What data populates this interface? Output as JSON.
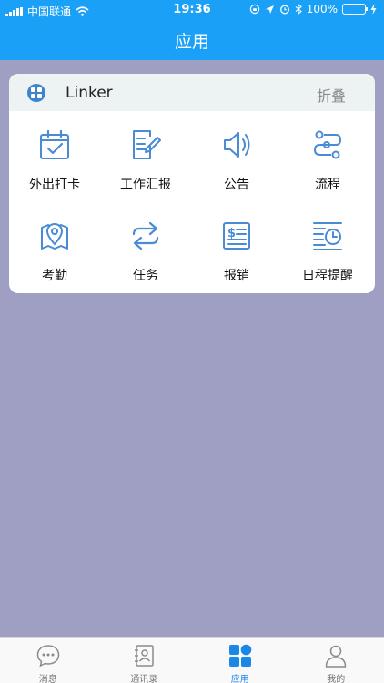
{
  "status_bar": {
    "carrier": "中国联通",
    "time": "19:36",
    "battery": "100%",
    "battery_level": 1.0
  },
  "header": {
    "title": "应用"
  },
  "card": {
    "app_name": "Linker",
    "fold_label": "折叠",
    "items": [
      {
        "label": "外出打卡",
        "icon": "calendar-check-icon"
      },
      {
        "label": "工作汇报",
        "icon": "report-edit-icon"
      },
      {
        "label": "公告",
        "icon": "speaker-icon"
      },
      {
        "label": "流程",
        "icon": "workflow-icon"
      },
      {
        "label": "考勤",
        "icon": "map-pin-icon"
      },
      {
        "label": "任务",
        "icon": "swap-arrows-icon"
      },
      {
        "label": "报销",
        "icon": "receipt-dollar-icon"
      },
      {
        "label": "日程提醒",
        "icon": "schedule-clock-icon"
      }
    ]
  },
  "tabbar": {
    "tabs": [
      {
        "label": "消息",
        "icon": "chat-bubble-icon"
      },
      {
        "label": "通讯录",
        "icon": "contacts-icon"
      },
      {
        "label": "应用",
        "icon": "apps-grid-icon",
        "active": true
      },
      {
        "label": "我的",
        "icon": "user-icon"
      }
    ]
  },
  "colors": {
    "header_blue": "#1aa1f7",
    "background": "#9f9fc4",
    "icon_blue": "#4a8bd6",
    "active_tab": "#1b88e8",
    "battery_green": "#44d64a"
  }
}
